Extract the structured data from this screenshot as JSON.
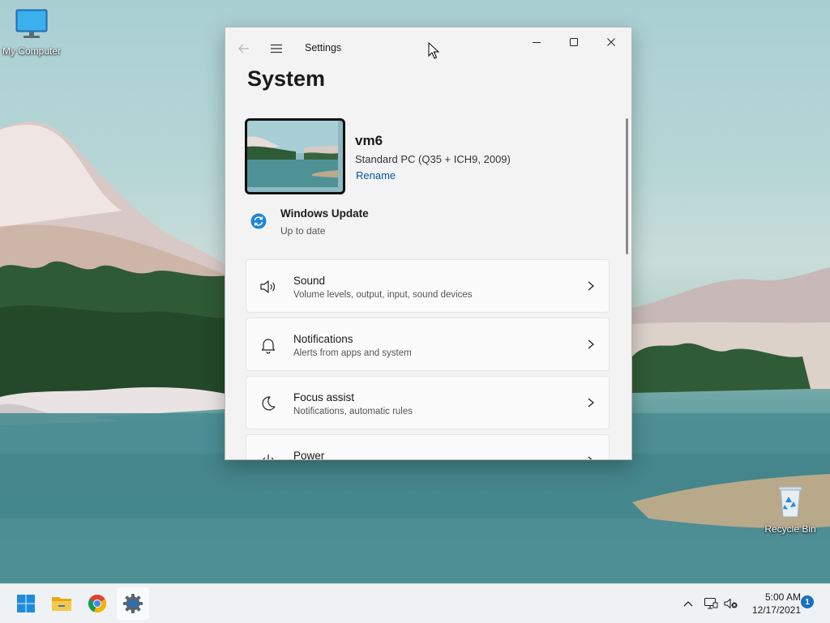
{
  "desktop": {
    "icons": [
      {
        "label": "My Computer",
        "icon": "monitor-icon"
      },
      {
        "label": "Recycle Bin",
        "icon": "recycle-bin-icon"
      }
    ]
  },
  "window": {
    "app_title": "Settings",
    "page_title": "System",
    "device": {
      "name": "vm6",
      "model": "Standard PC (Q35 + ICH9, 2009)",
      "rename_label": "Rename"
    },
    "windows_update": {
      "title": "Windows Update",
      "status": "Up to date"
    },
    "cards": [
      {
        "title": "Sound",
        "subtitle": "Volume levels, output, input, sound devices",
        "icon": "speaker-icon"
      },
      {
        "title": "Notifications",
        "subtitle": "Alerts from apps and system",
        "icon": "bell-icon"
      },
      {
        "title": "Focus assist",
        "subtitle": "Notifications, automatic rules",
        "icon": "moon-icon"
      },
      {
        "title": "Power",
        "subtitle": "",
        "icon": "power-icon"
      }
    ]
  },
  "taskbar": {
    "apps": [
      "start-icon",
      "file-explorer-icon",
      "chrome-icon",
      "settings-gear-icon"
    ],
    "clock": {
      "time": "5:00 AM",
      "date": "12/17/2021"
    },
    "notification_count": "1"
  },
  "colors": {
    "accent": "#005a9e",
    "window_bg": "#f3f3f3",
    "taskbar_bg": "#eef2f4"
  }
}
